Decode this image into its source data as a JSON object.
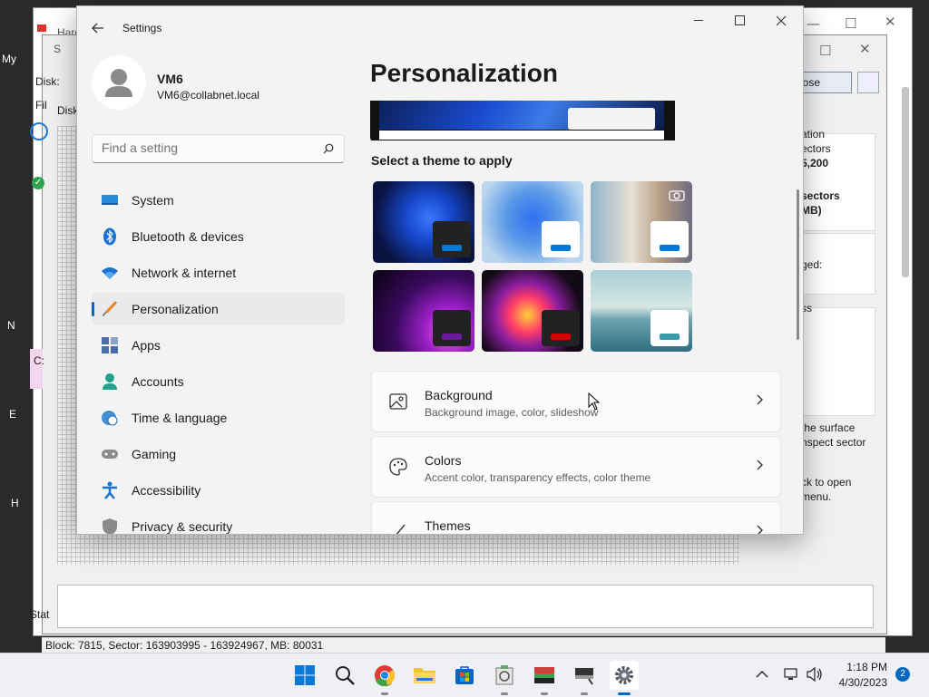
{
  "desktop": {
    "fragments": [
      "My",
      "N",
      "E",
      "H"
    ]
  },
  "background_window": {
    "title_fragment_1": "Hard",
    "title_fragment_2": "S",
    "menu_fragment": "Fil",
    "disk_label_1": "Disk:",
    "disk_label_2": "Disk",
    "drive_fragment": "C:",
    "close_button": "lose",
    "info_lines": [
      "ation",
      "ectors",
      "5,200",
      "sectors",
      "MB)",
      "ged:",
      "ss",
      "the surface",
      "nspect sector",
      ".",
      "ck to open",
      "menu."
    ],
    "status_fragment": "Stat",
    "status_bar": "Block: 7815, Sector: 163903995 - 163924967, MB: 80031"
  },
  "settings": {
    "title": "Settings",
    "user": {
      "name": "VM6",
      "email": "VM6@collabnet.local"
    },
    "search": {
      "placeholder": "Find a setting"
    },
    "nav": [
      {
        "label": "System",
        "icon": "system-icon"
      },
      {
        "label": "Bluetooth & devices",
        "icon": "bluetooth-icon"
      },
      {
        "label": "Network & internet",
        "icon": "wifi-icon"
      },
      {
        "label": "Personalization",
        "icon": "brush-icon",
        "selected": true
      },
      {
        "label": "Apps",
        "icon": "apps-icon"
      },
      {
        "label": "Accounts",
        "icon": "accounts-icon"
      },
      {
        "label": "Time & language",
        "icon": "globe-clock-icon"
      },
      {
        "label": "Gaming",
        "icon": "gamepad-icon"
      },
      {
        "label": "Accessibility",
        "icon": "accessibility-icon"
      },
      {
        "label": "Privacy & security",
        "icon": "shield-icon"
      }
    ],
    "page_title": "Personalization",
    "themes_heading": "Select a theme to apply",
    "themes": [
      {
        "name": "windows-dark",
        "accent": "#0078d4"
      },
      {
        "name": "windows-light",
        "accent": "#0078d4"
      },
      {
        "name": "windows-spotlight",
        "accent": "#0078d4"
      },
      {
        "name": "glow",
        "accent": "#6a1b9a"
      },
      {
        "name": "captured-motion",
        "accent": "#d50000"
      },
      {
        "name": "flow",
        "accent": "#3a9aa8"
      }
    ],
    "cards": [
      {
        "title": "Background",
        "subtitle": "Background image, color, slideshow",
        "icon": "image-icon"
      },
      {
        "title": "Colors",
        "subtitle": "Accent color, transparency effects, color theme",
        "icon": "palette-icon"
      },
      {
        "title": "Themes",
        "subtitle": "",
        "icon": "brush-icon"
      }
    ]
  },
  "taskbar": {
    "apps": [
      "start-button",
      "search",
      "chrome",
      "file-explorer",
      "microsoft-store",
      "disk-app",
      "hard-disk-app",
      "sector-app",
      "settings"
    ],
    "clock": {
      "time": "1:18 PM",
      "date": "4/30/2023"
    },
    "notification_count": "2"
  },
  "colors": {
    "accent": "#0067c0",
    "taskbar": "#eef0f4"
  }
}
